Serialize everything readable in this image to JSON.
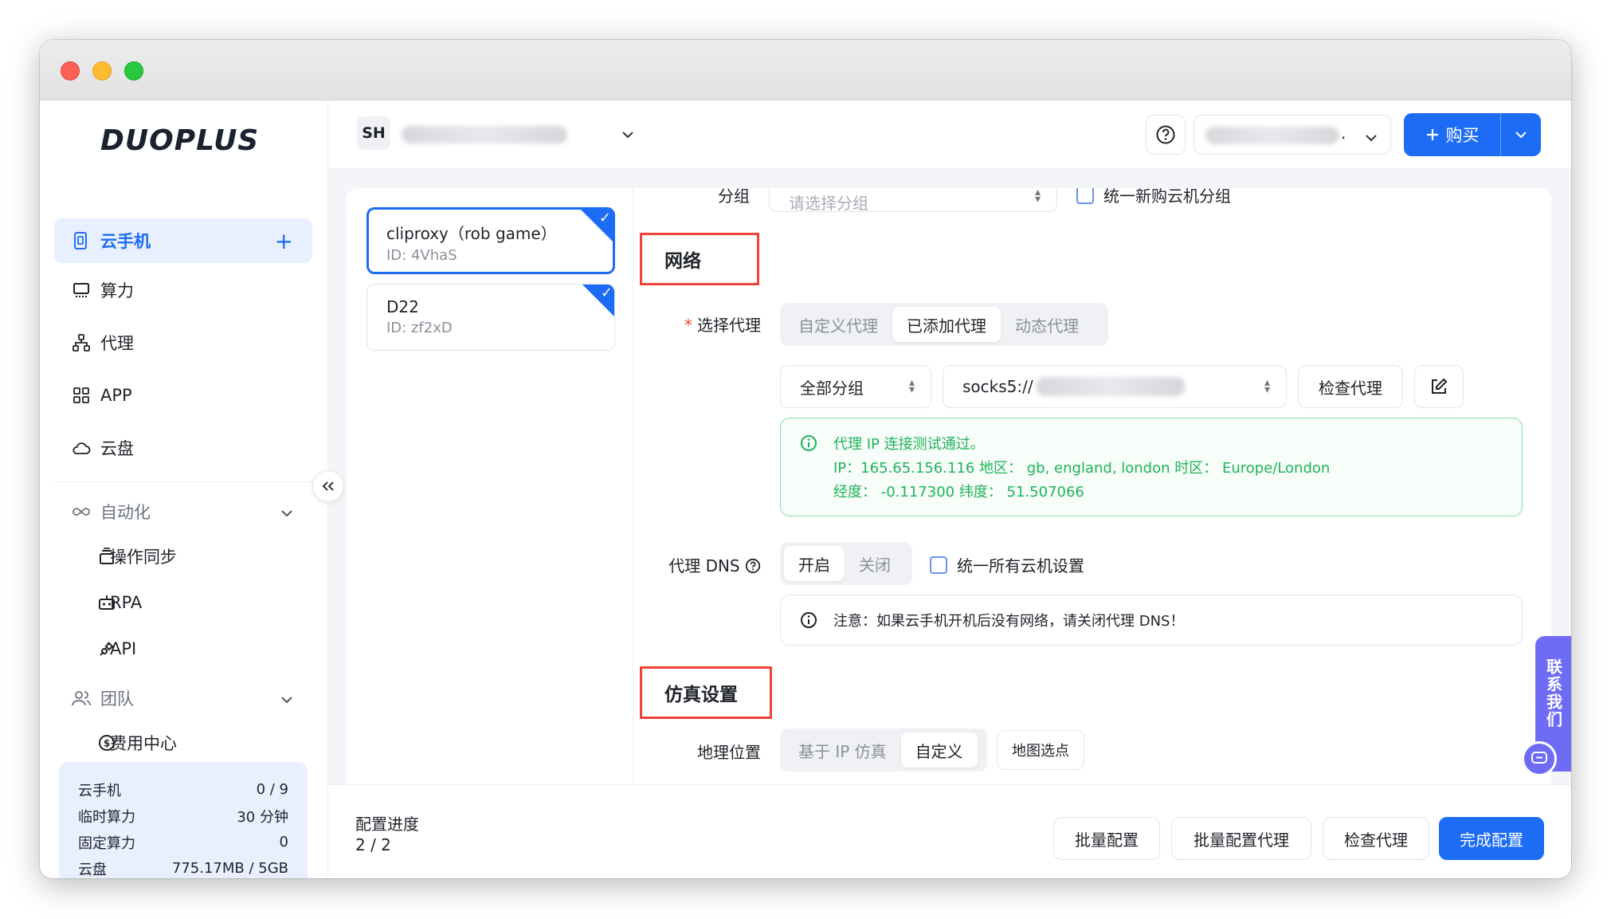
{
  "app": {
    "logo": "DUOPLUS"
  },
  "sidebar": {
    "items": [
      {
        "label": "云手机",
        "icon": "phone-icon"
      },
      {
        "label": "算力",
        "icon": "monitor-icon"
      },
      {
        "label": "代理",
        "icon": "network-icon"
      },
      {
        "label": "APP",
        "icon": "grid-icon"
      },
      {
        "label": "云盘",
        "icon": "cloud-icon"
      }
    ],
    "automation": {
      "label": "自动化",
      "children": [
        {
          "label": "操作同步",
          "icon": "stack-icon"
        },
        {
          "label": "RPA",
          "icon": "robot-icon"
        },
        {
          "label": "API",
          "icon": "plug-icon"
        }
      ]
    },
    "team": {
      "label": "团队",
      "children": [
        {
          "label": "费用中心",
          "icon": "dollar-icon"
        }
      ]
    },
    "stats": [
      {
        "label": "云手机",
        "value": "0 / 9"
      },
      {
        "label": "临时算力",
        "value": "30 分钟"
      },
      {
        "label": "固定算力",
        "value": "0"
      },
      {
        "label": "云盘",
        "value": "775.17MB / 5GB"
      }
    ]
  },
  "header": {
    "account_badge": "SH",
    "user_suffix": ".",
    "buy_label": "购买"
  },
  "devices": [
    {
      "name": "cliproxy（rob game）",
      "id": "ID: 4VhaS"
    },
    {
      "name": "D22",
      "id": "ID: zf2xD"
    }
  ],
  "form": {
    "group_label": "分组",
    "group_placeholder": "请选择分组",
    "group_unify": "统一新购云机分组",
    "network_section": "网络",
    "proxy_label": "选择代理",
    "proxy_tabs": [
      "自定义代理",
      "已添加代理",
      "动态代理"
    ],
    "proxy_group": "全部分组",
    "proxy_value": "socks5://",
    "check_proxy": "检查代理",
    "success": {
      "line1": "代理 IP 连接测试通过。",
      "line2": "IP：165.65.156.116  地区：  gb, england, london  时区：  Europe/London",
      "line3": "经度：  -0.117300  纬度：  51.507066"
    },
    "dns_label": "代理 DNS",
    "dns_tabs": [
      "开启",
      "关闭"
    ],
    "dns_unify": "统一所有云机设置",
    "dns_note": "注意：如果云手机开机后没有网络，请关闭代理 DNS！",
    "sim_section": "仿真设置",
    "geo_label": "地理位置",
    "geo_tabs": [
      "基于 IP 仿真",
      "自定义"
    ],
    "map_pick": "地图选点"
  },
  "footer": {
    "progress_label": "配置进度",
    "progress_value": "2 / 2",
    "batch_config": "批量配置",
    "batch_proxy": "批量配置代理",
    "check_proxy": "检查代理",
    "finish": "完成配置"
  },
  "contact": {
    "label": "联系我们"
  }
}
